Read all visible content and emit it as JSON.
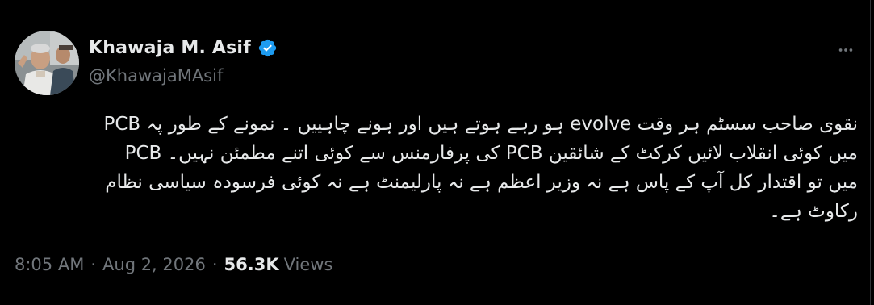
{
  "author": {
    "display_name": "Khawaja M. Asif",
    "handle": "@KhawajaMAsif",
    "verified_icon": "verified-badge-icon",
    "verified_color": "#1d9bf0"
  },
  "more_icon": "more-horizontal-icon",
  "tweet": {
    "lines": [
      "نقوی صاحب سسٹم ہر وقت evolve ہو رہے ہوتے ہیں اور ہونے چاہییں ۔ نمونے کے طور پہ PCB",
      "میں کوئی انقلاب لائیں کرکٹ کے شائقین PCB کی پرفارمنس سے کوئی اتنے مطمئن نہیں۔ PCB",
      "میں  تو  اقتدار کل آپ کے  پاس ہے نہ وزیر اعظم ہے نہ پارلیمنٹ ہے نہ کوئی فرسودہ سیاسی نظام",
      "رکاوٹ ہے۔"
    ]
  },
  "meta": {
    "time": "8:05 AM",
    "separator": "·",
    "date": "Aug 2, 2026",
    "views_count": "56.3K",
    "views_label": "Views"
  },
  "colors": {
    "background": "#000000",
    "text_primary": "#e7e9ea",
    "text_secondary": "#71767b",
    "divider": "#2f3336"
  }
}
